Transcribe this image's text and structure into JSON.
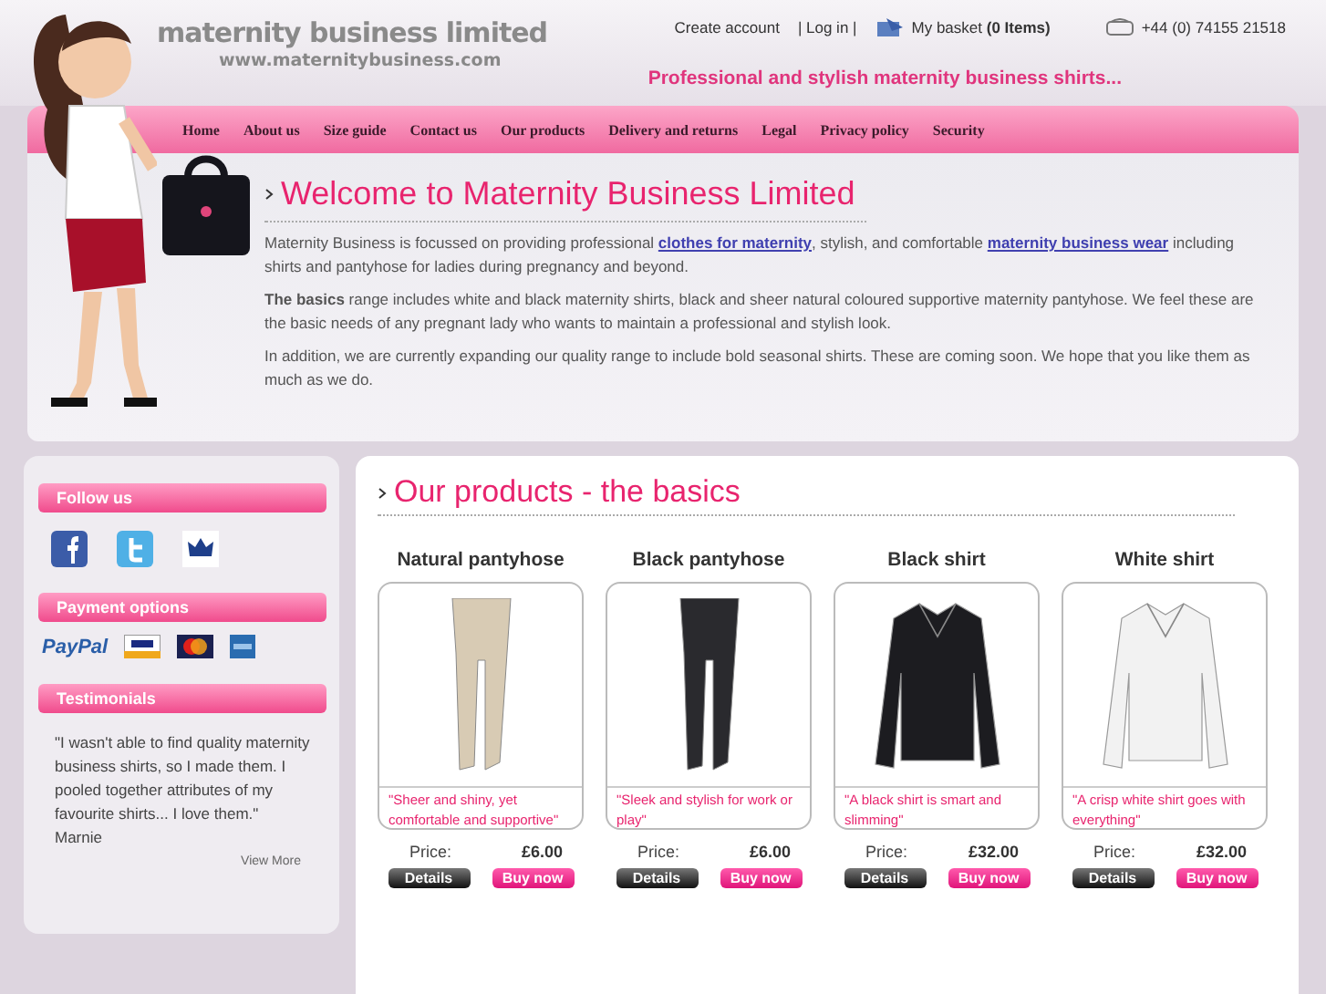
{
  "header": {
    "logo_title": "maternity business limited",
    "logo_url": "www.maternitybusiness.com",
    "links": [
      "Create account",
      "| Log in |"
    ],
    "basket": {
      "label": "My basket",
      "count": "(0 Items)"
    },
    "phone": "+44 (0) 74155 21518",
    "tagline": "Professional and stylish maternity business shirts..."
  },
  "nav": [
    "Home",
    "About us",
    "Size guide",
    "Contact us",
    "Our products",
    "Delivery and returns",
    "Legal",
    "Privacy policy",
    "Security"
  ],
  "welcome": {
    "title": "Welcome to Maternity Business Limited",
    "paragraphs": [
      {
        "parts": [
          {
            "kind": "text",
            "text": "Maternity Business is focussed on providing professional "
          },
          {
            "kind": "link",
            "text": "clothes for maternity"
          },
          {
            "kind": "text",
            "text": ", stylish, and comfortable "
          },
          {
            "kind": "link",
            "text": "maternity business wear"
          },
          {
            "kind": "text",
            "text": " including shirts and pantyhose for ladies during pregnancy and beyond."
          }
        ]
      },
      {
        "parts": [
          {
            "kind": "text",
            "text": "**The basics** range includes white and black maternity shirts, black and sheer natural coloured supportive maternity pantyhose. We feel these are the basic needs of any pregnant lady who wants to maintain a professional and stylish look."
          }
        ]
      },
      {
        "parts": [
          {
            "kind": "text",
            "text": "In addition, we are currently expanding our quality range to include bold seasonal shirts. These are coming soon. We hope that you like them as much as we do."
          }
        ]
      }
    ]
  },
  "sidebar": {
    "follow_title": "Follow us",
    "payment_title": "Payment options",
    "payment_paypal": "PayPal",
    "testimonials_title": "Testimonials",
    "testimonial": "\"I wasn't able to find quality maternity business shirts, so I made them. I pooled together attributes of my favourite shirts... I love them.\"",
    "author": "Marnie",
    "view_more": "View More"
  },
  "products": {
    "title": "Our products - the basics",
    "items": [
      {
        "name": "Natural pantyhose",
        "kind": "pantyhose",
        "color": "#d8cbb4",
        "caption": "\"Sheer and shiny, yet comfortable and supportive\"",
        "price_label": "Price:",
        "price": "£6.00",
        "details": "Details",
        "buy": "Buy now"
      },
      {
        "name": "Black pantyhose",
        "kind": "pantyhose",
        "color": "#2a2a2e",
        "caption": "\"Sleek and stylish for work or play\"",
        "price_label": "Price:",
        "price": "£6.00",
        "details": "Details",
        "buy": "Buy now"
      },
      {
        "name": "Black shirt",
        "kind": "shirt",
        "color": "#1c1c20",
        "caption": "\"A black shirt is smart and slimming\"",
        "price_label": "Price:",
        "price": "£32.00",
        "details": "Details",
        "buy": "Buy now"
      },
      {
        "name": "White shirt",
        "kind": "shirt",
        "color": "#f2f2f2",
        "caption": "\"A crisp white shirt goes with everything\"",
        "price_label": "Price:",
        "price": "£32.00",
        "details": "Details",
        "buy": "Buy now"
      }
    ]
  }
}
